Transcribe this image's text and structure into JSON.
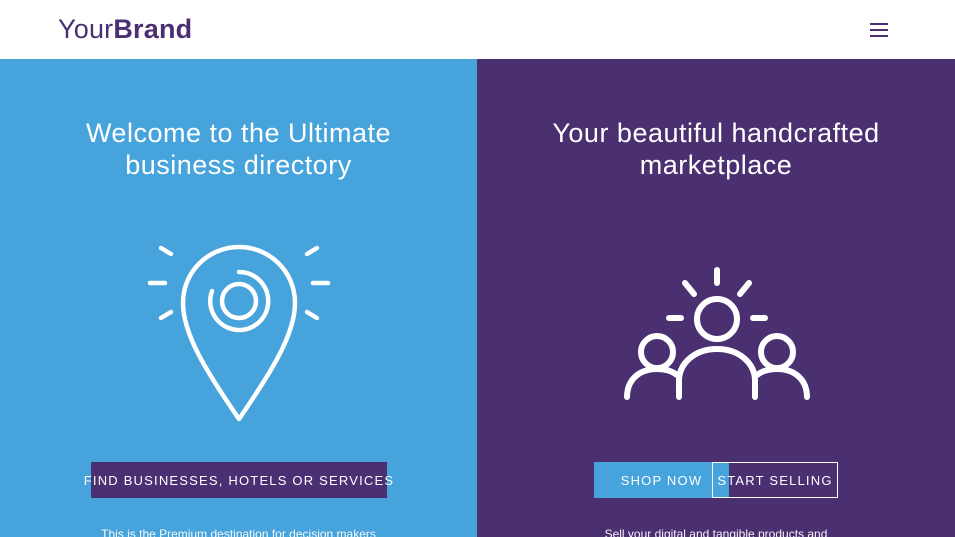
{
  "header": {
    "brand_light": "Your",
    "brand_bold": "Brand",
    "menu_icon": "hamburger-menu-icon"
  },
  "left_panel": {
    "title": "Welcome to the Ultimate\nbusiness directory",
    "icon": "location-pin-icon",
    "button_label": "FIND BUSINESSES, HOTELS OR SERVICES",
    "footer_text": "This is the Premium destination for decision makers"
  },
  "right_panel": {
    "title": "Your beautiful handcrafted\nmarketplace",
    "icon": "community-people-icon",
    "shop_label": "SHOP NOW",
    "sell_label": "START SELLING",
    "footer_text": "Sell your digital and tangible products and"
  },
  "colors": {
    "brand_purple": "#4a2f73",
    "sky_blue": "#46a3db",
    "white": "#ffffff"
  }
}
